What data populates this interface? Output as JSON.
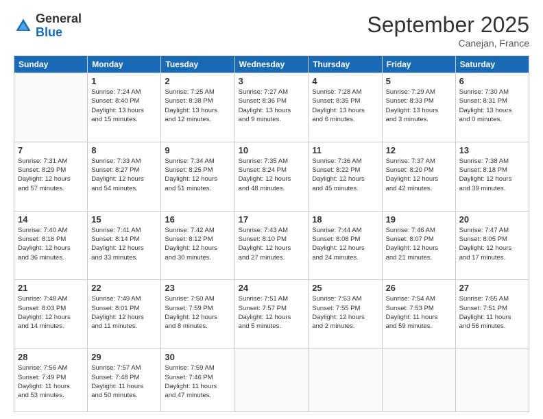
{
  "logo": {
    "general": "General",
    "blue": "Blue"
  },
  "header": {
    "month": "September 2025",
    "location": "Canejan, France"
  },
  "days_of_week": [
    "Sunday",
    "Monday",
    "Tuesday",
    "Wednesday",
    "Thursday",
    "Friday",
    "Saturday"
  ],
  "weeks": [
    [
      {
        "day": "",
        "info": ""
      },
      {
        "day": "1",
        "info": "Sunrise: 7:24 AM\nSunset: 8:40 PM\nDaylight: 13 hours\nand 15 minutes."
      },
      {
        "day": "2",
        "info": "Sunrise: 7:25 AM\nSunset: 8:38 PM\nDaylight: 13 hours\nand 12 minutes."
      },
      {
        "day": "3",
        "info": "Sunrise: 7:27 AM\nSunset: 8:36 PM\nDaylight: 13 hours\nand 9 minutes."
      },
      {
        "day": "4",
        "info": "Sunrise: 7:28 AM\nSunset: 8:35 PM\nDaylight: 13 hours\nand 6 minutes."
      },
      {
        "day": "5",
        "info": "Sunrise: 7:29 AM\nSunset: 8:33 PM\nDaylight: 13 hours\nand 3 minutes."
      },
      {
        "day": "6",
        "info": "Sunrise: 7:30 AM\nSunset: 8:31 PM\nDaylight: 13 hours\nand 0 minutes."
      }
    ],
    [
      {
        "day": "7",
        "info": "Sunrise: 7:31 AM\nSunset: 8:29 PM\nDaylight: 12 hours\nand 57 minutes."
      },
      {
        "day": "8",
        "info": "Sunrise: 7:33 AM\nSunset: 8:27 PM\nDaylight: 12 hours\nand 54 minutes."
      },
      {
        "day": "9",
        "info": "Sunrise: 7:34 AM\nSunset: 8:25 PM\nDaylight: 12 hours\nand 51 minutes."
      },
      {
        "day": "10",
        "info": "Sunrise: 7:35 AM\nSunset: 8:24 PM\nDaylight: 12 hours\nand 48 minutes."
      },
      {
        "day": "11",
        "info": "Sunrise: 7:36 AM\nSunset: 8:22 PM\nDaylight: 12 hours\nand 45 minutes."
      },
      {
        "day": "12",
        "info": "Sunrise: 7:37 AM\nSunset: 8:20 PM\nDaylight: 12 hours\nand 42 minutes."
      },
      {
        "day": "13",
        "info": "Sunrise: 7:38 AM\nSunset: 8:18 PM\nDaylight: 12 hours\nand 39 minutes."
      }
    ],
    [
      {
        "day": "14",
        "info": "Sunrise: 7:40 AM\nSunset: 8:16 PM\nDaylight: 12 hours\nand 36 minutes."
      },
      {
        "day": "15",
        "info": "Sunrise: 7:41 AM\nSunset: 8:14 PM\nDaylight: 12 hours\nand 33 minutes."
      },
      {
        "day": "16",
        "info": "Sunrise: 7:42 AM\nSunset: 8:12 PM\nDaylight: 12 hours\nand 30 minutes."
      },
      {
        "day": "17",
        "info": "Sunrise: 7:43 AM\nSunset: 8:10 PM\nDaylight: 12 hours\nand 27 minutes."
      },
      {
        "day": "18",
        "info": "Sunrise: 7:44 AM\nSunset: 8:08 PM\nDaylight: 12 hours\nand 24 minutes."
      },
      {
        "day": "19",
        "info": "Sunrise: 7:46 AM\nSunset: 8:07 PM\nDaylight: 12 hours\nand 21 minutes."
      },
      {
        "day": "20",
        "info": "Sunrise: 7:47 AM\nSunset: 8:05 PM\nDaylight: 12 hours\nand 17 minutes."
      }
    ],
    [
      {
        "day": "21",
        "info": "Sunrise: 7:48 AM\nSunset: 8:03 PM\nDaylight: 12 hours\nand 14 minutes."
      },
      {
        "day": "22",
        "info": "Sunrise: 7:49 AM\nSunset: 8:01 PM\nDaylight: 12 hours\nand 11 minutes."
      },
      {
        "day": "23",
        "info": "Sunrise: 7:50 AM\nSunset: 7:59 PM\nDaylight: 12 hours\nand 8 minutes."
      },
      {
        "day": "24",
        "info": "Sunrise: 7:51 AM\nSunset: 7:57 PM\nDaylight: 12 hours\nand 5 minutes."
      },
      {
        "day": "25",
        "info": "Sunrise: 7:53 AM\nSunset: 7:55 PM\nDaylight: 12 hours\nand 2 minutes."
      },
      {
        "day": "26",
        "info": "Sunrise: 7:54 AM\nSunset: 7:53 PM\nDaylight: 11 hours\nand 59 minutes."
      },
      {
        "day": "27",
        "info": "Sunrise: 7:55 AM\nSunset: 7:51 PM\nDaylight: 11 hours\nand 56 minutes."
      }
    ],
    [
      {
        "day": "28",
        "info": "Sunrise: 7:56 AM\nSunset: 7:49 PM\nDaylight: 11 hours\nand 53 minutes."
      },
      {
        "day": "29",
        "info": "Sunrise: 7:57 AM\nSunset: 7:48 PM\nDaylight: 11 hours\nand 50 minutes."
      },
      {
        "day": "30",
        "info": "Sunrise: 7:59 AM\nSunset: 7:46 PM\nDaylight: 11 hours\nand 47 minutes."
      },
      {
        "day": "",
        "info": ""
      },
      {
        "day": "",
        "info": ""
      },
      {
        "day": "",
        "info": ""
      },
      {
        "day": "",
        "info": ""
      }
    ]
  ]
}
